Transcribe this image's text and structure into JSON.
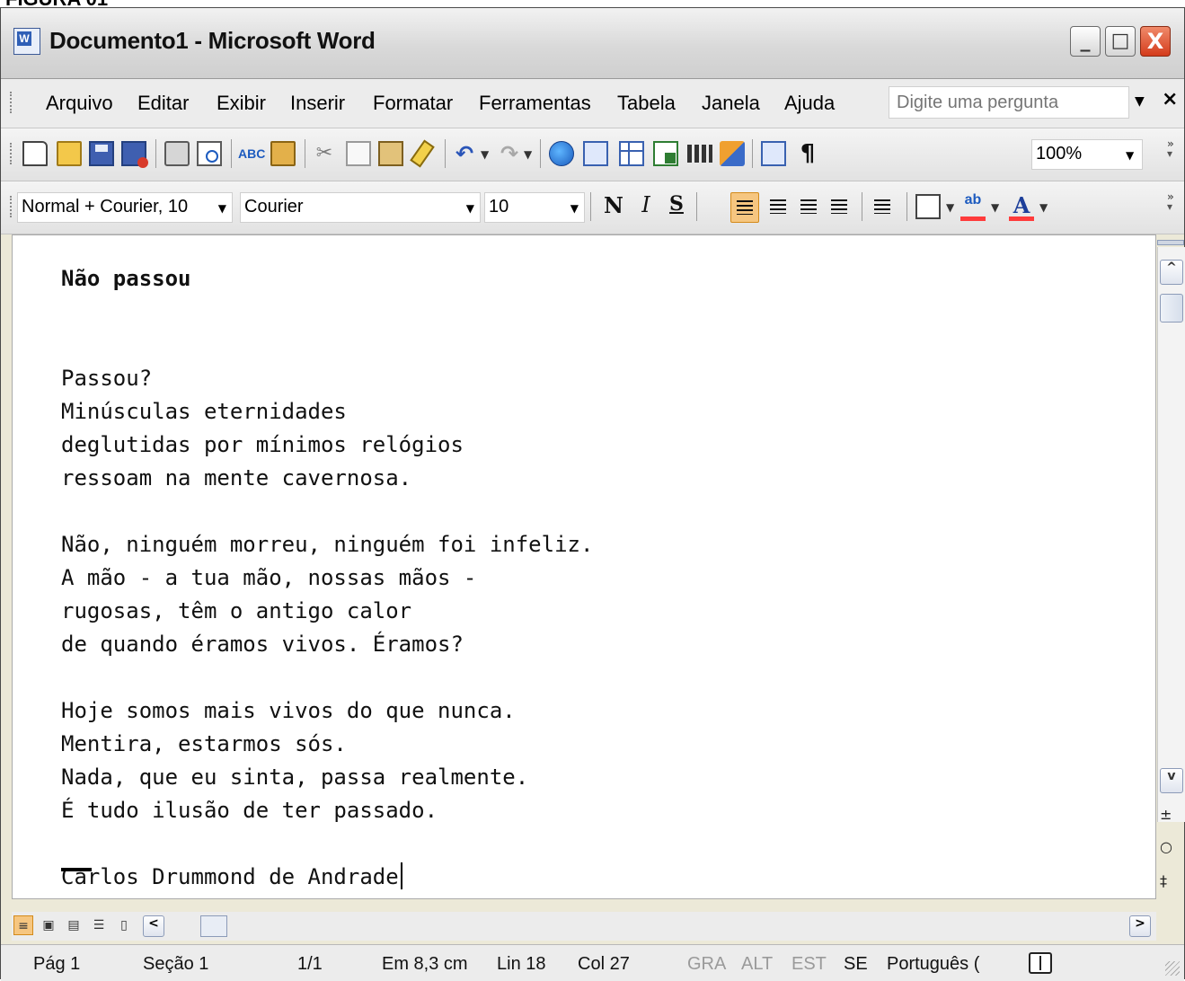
{
  "caption": "FIGURA 01",
  "window": {
    "title": "Documento1 - Microsoft Word",
    "app_icon_glyph": "W",
    "minimize_glyph": "_",
    "maximize_glyph": "□",
    "close_glyph": "X"
  },
  "menu": {
    "items": [
      "Arquivo",
      "Editar",
      "Exibir",
      "Inserir",
      "Formatar",
      "Ferramentas",
      "Tabela",
      "Janela",
      "Ajuda"
    ],
    "ask_placeholder": "Digite uma pergunta",
    "doc_close": "×"
  },
  "standard_toolbar": {
    "spelling_glyph": "ABC",
    "cut_glyph": "✂",
    "undo_glyph": "↶",
    "redo_glyph": "↷",
    "show_hide_glyph": "¶",
    "zoom": "100%"
  },
  "formatting_toolbar": {
    "style": "Normal + Courier, 10",
    "font": "Courier",
    "size": "10",
    "bold_label": "N",
    "italic_label": "I",
    "underline_label": "S",
    "highlight_label": "ab",
    "font_color_label": "A"
  },
  "document": {
    "title": "Não passou",
    "stanzas": [
      [
        "Passou?",
        "Minúsculas eternidades",
        "deglutidas por mínimos relógios",
        "ressoam na mente cavernosa."
      ],
      [
        "Não, ninguém morreu, ninguém foi infeliz.",
        "A mão - a tua mão, nossas mãos -",
        "rugosas, têm o antigo calor",
        "de quando éramos vivos. Éramos?"
      ],
      [
        "Hoje somos mais vivos do que nunca.",
        "Mentira, estarmos sós.",
        "Nada, que eu sinta, passa realmente.",
        "É tudo ilusão de ter passado."
      ]
    ],
    "author": "Carlos Drummond de Andrade"
  },
  "scroll": {
    "up": "^",
    "down": "v",
    "prev_page": "±",
    "select_browse": "○",
    "next_page": "‡",
    "left": "<",
    "right": ">"
  },
  "status": {
    "page": "Pág 1",
    "section": "Seção 1",
    "pages": "1/1",
    "at": "Em 8,3 cm",
    "line": "Lin 18",
    "col": "Col 27",
    "rec": "GRA",
    "trk": "ALT",
    "ext": "EST",
    "ovr": "SE",
    "language": "Português ("
  }
}
